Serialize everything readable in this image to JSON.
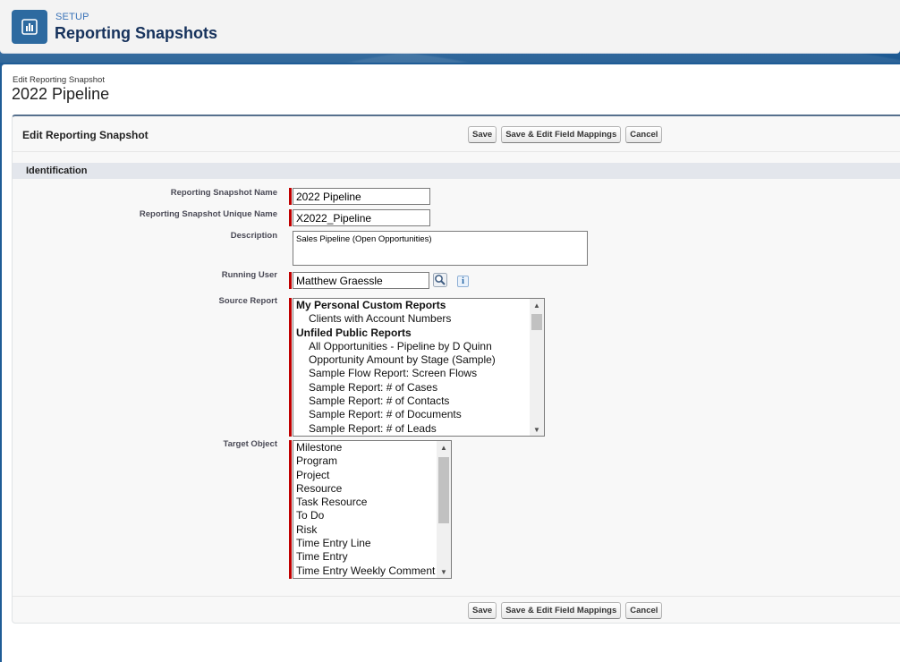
{
  "header": {
    "eyebrow": "SETUP",
    "title": "Reporting Snapshots",
    "icon": "report-chart-icon"
  },
  "page": {
    "eyebrow": "Edit Reporting Snapshot",
    "title": "2022 Pipeline"
  },
  "block": {
    "title": "Edit Reporting Snapshot",
    "buttons": {
      "save": "Save",
      "save_edit_mappings": "Save & Edit Field Mappings",
      "cancel": "Cancel"
    }
  },
  "section": {
    "title": "Identification"
  },
  "fields": {
    "name": {
      "label": "Reporting Snapshot Name",
      "value": "2022 Pipeline"
    },
    "unique_name": {
      "label": "Reporting Snapshot Unique Name",
      "value": "X2022_Pipeline"
    },
    "description": {
      "label": "Description",
      "value": "Sales Pipeline (Open Opportunities)"
    },
    "running_user": {
      "label": "Running User",
      "value": "Matthew Graessle"
    },
    "source_report": {
      "label": "Source Report",
      "options": [
        {
          "text": "My Personal Custom Reports",
          "group": true
        },
        {
          "text": "Clients with Account Numbers",
          "group": false
        },
        {
          "text": "Unfiled Public Reports",
          "group": true
        },
        {
          "text": "All Opportunities - Pipeline by D Quinn",
          "group": false
        },
        {
          "text": "Opportunity Amount by Stage (Sample)",
          "group": false
        },
        {
          "text": "Sample Flow Report: Screen Flows",
          "group": false
        },
        {
          "text": "Sample Report: # of Cases",
          "group": false
        },
        {
          "text": "Sample Report: # of Contacts",
          "group": false
        },
        {
          "text": "Sample Report: # of Documents",
          "group": false
        },
        {
          "text": "Sample Report: # of Leads",
          "group": false
        }
      ]
    },
    "target_object": {
      "label": "Target Object",
      "options": [
        "Milestone",
        "Program",
        "Project",
        "Resource",
        "Task Resource",
        "To Do",
        "Risk",
        "Time Entry Line",
        "Time Entry",
        "Time Entry Weekly Comment"
      ]
    }
  },
  "colors": {
    "brand_blue": "#1d5fa0",
    "required_bar": "#c00000",
    "section_bar": "#e3e6ec"
  }
}
